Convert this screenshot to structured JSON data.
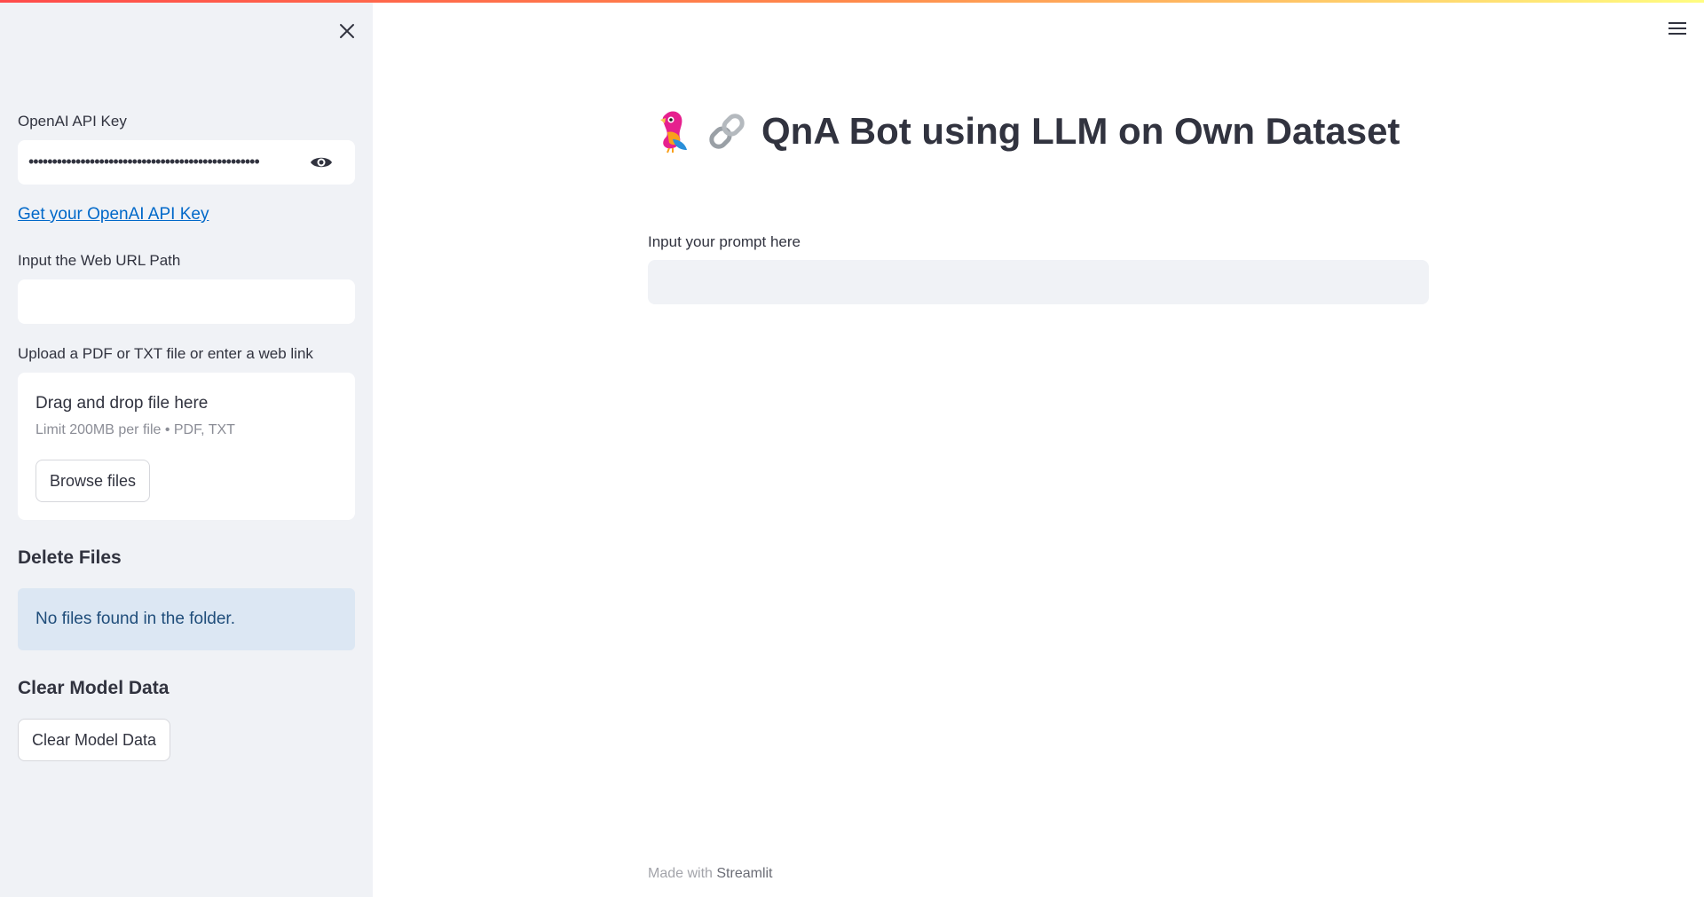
{
  "sidebar": {
    "api_key_label": "OpenAI API Key",
    "api_key_value": "•••••••••••••••••••••••••••••••••••••••••••••••••",
    "get_key_link": "Get your OpenAI API Key",
    "web_url_label": "Input the Web URL Path",
    "web_url_value": "",
    "upload_label": "Upload a PDF or TXT file or enter a web link",
    "dropzone_title": "Drag and drop file here",
    "dropzone_limit": "Limit 200MB per file • PDF, TXT",
    "browse_button": "Browse files",
    "delete_heading": "Delete Files",
    "delete_info": "No files found in the folder.",
    "clear_heading": "Clear Model Data",
    "clear_button": "Clear Model Data"
  },
  "main": {
    "title_emoji_1": "🦜",
    "title_emoji_2": "🔗",
    "title": "QnA Bot using LLM on Own Dataset",
    "prompt_label": "Input your prompt here",
    "prompt_value": ""
  },
  "footer": {
    "prefix": "Made with",
    "brand": "Streamlit"
  },
  "colors": {
    "sidebar_bg": "#f0f2f6",
    "link": "#0068c9",
    "info_bg": "#dce7f3",
    "text": "#31333f"
  }
}
